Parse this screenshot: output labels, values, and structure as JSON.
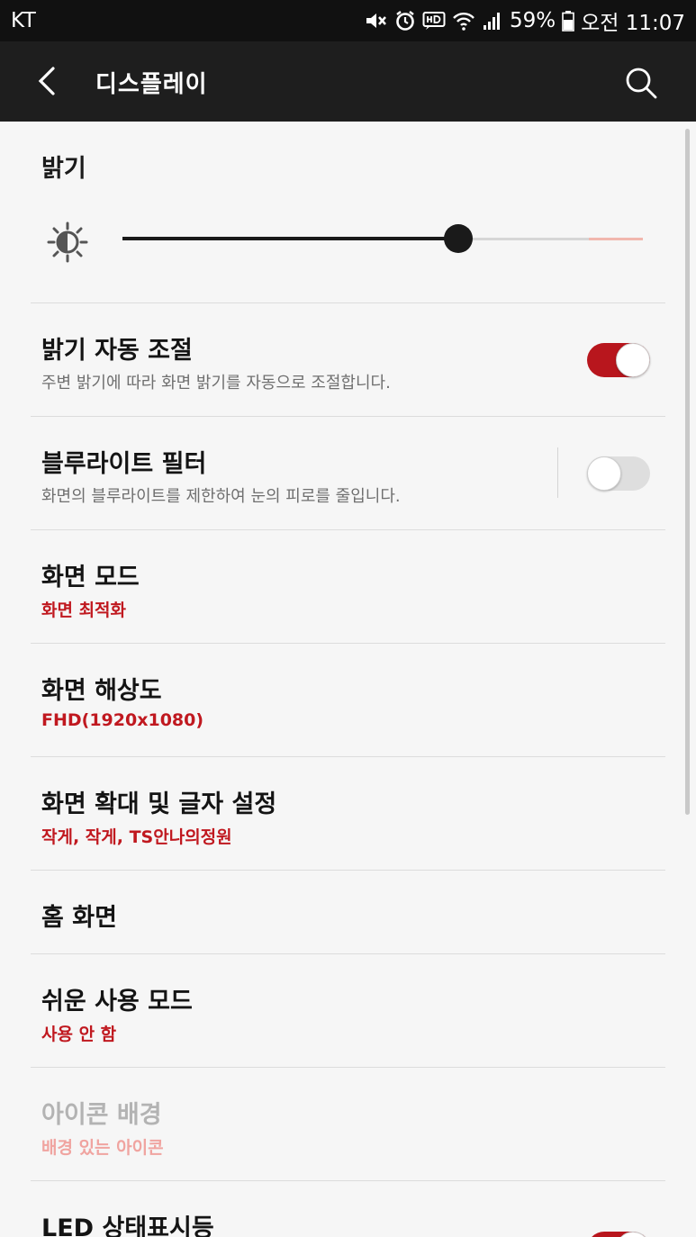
{
  "status_bar": {
    "carrier": "KT",
    "battery": "59%",
    "time": "오전 11:07",
    "icons": [
      "mute-icon",
      "alarm-icon",
      "hd-voice-icon",
      "wifi-icon",
      "signal-icon",
      "battery-icon"
    ]
  },
  "app_bar": {
    "title": "디스플레이",
    "back_icon": "back-arrow-icon",
    "search_icon": "search-icon"
  },
  "brightness": {
    "title": "밝기",
    "level": 0.72,
    "icon": "brightness-icon"
  },
  "settings": [
    {
      "id": "auto-brightness",
      "title": "밝기 자동 조절",
      "subtitle": "주변 밝기에 따라 화면 밝기를 자동으로 조절합니다.",
      "toggle": true
    },
    {
      "id": "blue-light-filter",
      "title": "블루라이트 필터",
      "subtitle": "화면의 블루라이트를 제한하여 눈의 피로를 줄입니다.",
      "toggle": false
    },
    {
      "id": "screen-mode",
      "title": "화면 모드",
      "value": "화면 최적화"
    },
    {
      "id": "screen-resolution",
      "title": "화면 해상도",
      "value": "FHD(1920x1080)"
    },
    {
      "id": "zoom-font",
      "title": "화면 확대 및 글자 설정",
      "value": "작게, 작게, TS안나의정원"
    },
    {
      "id": "home-screen",
      "title": "홈 화면"
    },
    {
      "id": "easy-mode",
      "title": "쉬운 사용 모드",
      "value": "사용 안 함"
    },
    {
      "id": "icon-frames",
      "title": "아이콘 배경",
      "value": "배경 있는 아이콘",
      "disabled": true
    },
    {
      "id": "led-indicator",
      "title": "LED 상태표시등",
      "toggle": true
    }
  ],
  "colors": {
    "accent": "#c0181f",
    "toggle_on": "#b8161d",
    "status_bar": "#111111",
    "app_bar": "#1e1e1e",
    "background": "#f6f6f6"
  }
}
